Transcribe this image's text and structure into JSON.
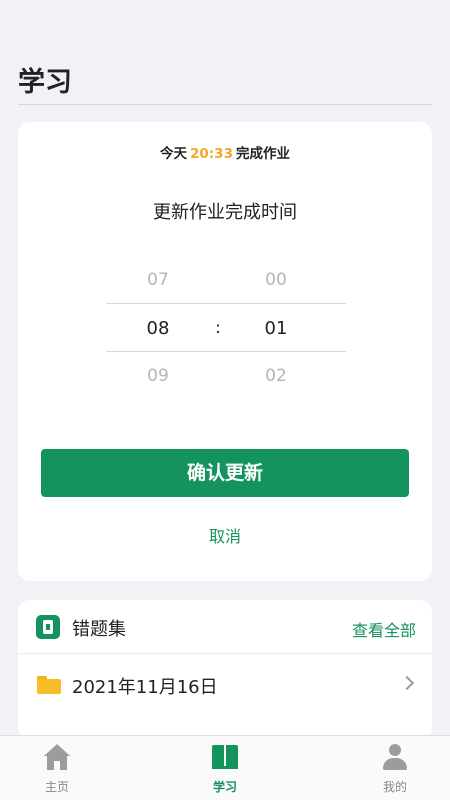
{
  "page": {
    "title": "学习"
  },
  "update_card": {
    "status_prefix": "今天",
    "status_time": "20:33",
    "status_suffix": "完成作业",
    "title": "更新作业完成时间",
    "picker": {
      "hours": [
        "07",
        "08",
        "09"
      ],
      "minutes": [
        "00",
        "01",
        "02"
      ],
      "selected_hour": "08",
      "selected_minute": "01",
      "separator": ":"
    },
    "confirm_label": "确认更新",
    "cancel_label": "取消"
  },
  "mistakes_card": {
    "title": "错题集",
    "view_all_label": "查看全部",
    "items": [
      {
        "date": "2021年11月16日"
      }
    ]
  },
  "tabbar": {
    "items": [
      {
        "label": "主页",
        "icon": "home-icon",
        "active": false
      },
      {
        "label": "学习",
        "icon": "book-icon",
        "active": true
      },
      {
        "label": "我的",
        "icon": "user-icon",
        "active": false
      }
    ]
  },
  "colors": {
    "accent": "#14935f",
    "time_highlight": "#f5a623",
    "background": "#f2f2f6"
  }
}
